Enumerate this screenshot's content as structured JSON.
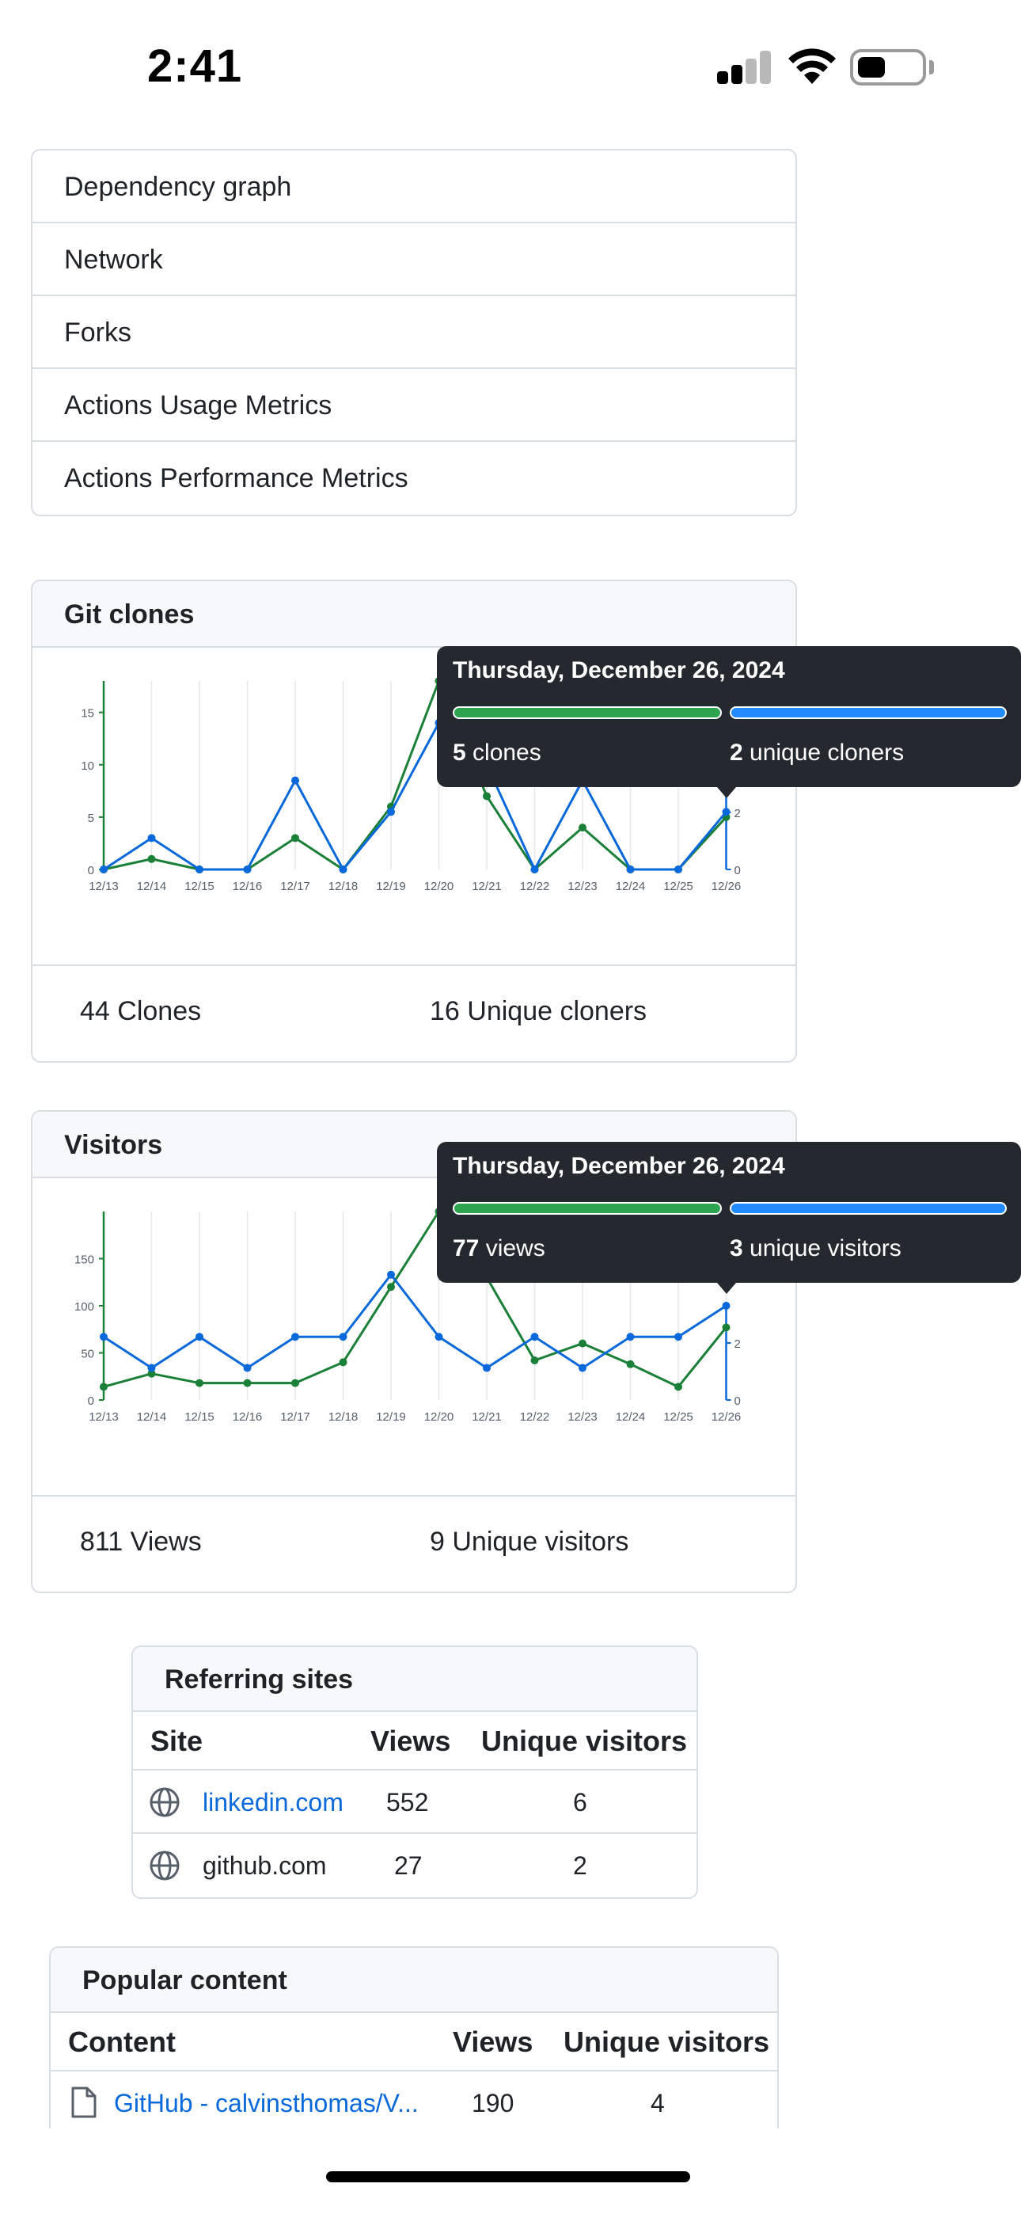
{
  "status_bar": {
    "time": "2:41"
  },
  "nav_items": [
    "Dependency graph",
    "Network",
    "Forks",
    "Actions Usage Metrics",
    "Actions Performance Metrics"
  ],
  "git_clones": {
    "title": "Git clones",
    "footer": {
      "total": "44 Clones",
      "unique": "16 Unique cloners"
    },
    "tooltip": {
      "date": "Thursday, December 26, 2024",
      "primary_value": "5",
      "primary_label": " clones",
      "secondary_value": "2",
      "secondary_label": " unique cloners"
    }
  },
  "visitors": {
    "title": "Visitors",
    "footer": {
      "total": "811 Views",
      "unique": "9 Unique visitors"
    },
    "tooltip": {
      "date": "Thursday, December 26, 2024",
      "primary_value": "77",
      "primary_label": " views",
      "secondary_value": "3",
      "secondary_label": " unique visitors"
    }
  },
  "colors": {
    "green": "#1a7f37",
    "blue": "#0969da",
    "link": "#0969da"
  },
  "chart_data": [
    {
      "type": "line",
      "x": [
        "12/13",
        "12/14",
        "12/15",
        "12/16",
        "12/17",
        "12/18",
        "12/19",
        "12/20",
        "12/21",
        "12/22",
        "12/23",
        "12/24",
        "12/25",
        "12/26"
      ],
      "ylim": [
        0,
        18
      ],
      "yticks": [
        0,
        5,
        10,
        15
      ],
      "right_yticks": [
        "0",
        "2"
      ],
      "series": [
        {
          "name": "clones",
          "color": "#1a7f37",
          "values": [
            0,
            1,
            0,
            0,
            3,
            0,
            6,
            18,
            7,
            0,
            4,
            0,
            0,
            5
          ]
        },
        {
          "name": "unique cloners",
          "color": "#0969da",
          "values": [
            0,
            3,
            0,
            0,
            8.5,
            0,
            5.5,
            14,
            10,
            0,
            8.5,
            0,
            0,
            5.5
          ]
        }
      ]
    },
    {
      "type": "line",
      "x": [
        "12/13",
        "12/14",
        "12/15",
        "12/16",
        "12/17",
        "12/18",
        "12/19",
        "12/20",
        "12/21",
        "12/22",
        "12/23",
        "12/24",
        "12/25",
        "12/26"
      ],
      "ylim": [
        0,
        200
      ],
      "yticks": [
        0,
        50,
        100,
        150
      ],
      "right_yticks": [
        "0",
        "2"
      ],
      "series": [
        {
          "name": "views",
          "color": "#1a7f37",
          "values": [
            14,
            28,
            18,
            18,
            18,
            40,
            120,
            200,
            130,
            42,
            60,
            38,
            14,
            77
          ]
        },
        {
          "name": "unique visitors",
          "color": "#0969da",
          "values": [
            67,
            34,
            67,
            34,
            67,
            67,
            133,
            67,
            34,
            67,
            34,
            67,
            67,
            100
          ]
        }
      ]
    }
  ],
  "referring_sites": {
    "title": "Referring sites",
    "headers": [
      "Site",
      "Views",
      "Unique visitors"
    ],
    "rows": [
      {
        "site": "linkedin.com",
        "views": "552",
        "unique": "6",
        "is_link": true
      },
      {
        "site": "github.com",
        "views": "27",
        "unique": "2",
        "is_link": false
      }
    ]
  },
  "popular_content": {
    "title": "Popular content",
    "headers": [
      "Content",
      "Views",
      "Unique visitors"
    ],
    "rows": [
      {
        "content": "GitHub - calvinsthomas/V...",
        "views": "190",
        "unique": "4"
      }
    ]
  }
}
